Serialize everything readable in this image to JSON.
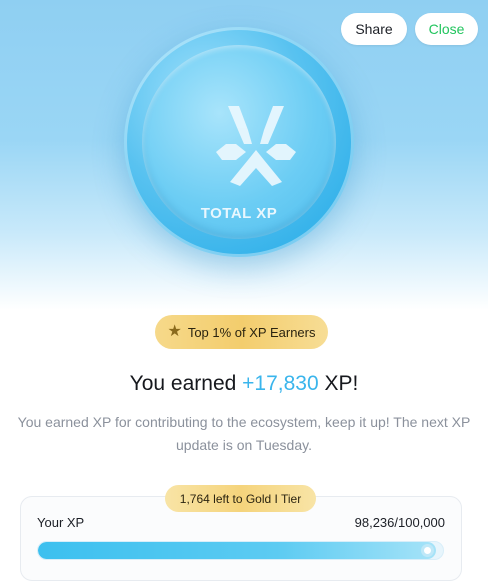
{
  "header": {
    "share_label": "Share",
    "close_label": "Close"
  },
  "coin": {
    "label": "TOTAL XP",
    "icon": "xp-logo-icon"
  },
  "badge": {
    "icon": "star-icon",
    "text": "Top 1% of XP Earners"
  },
  "headline": {
    "prefix": "You earned ",
    "amount": "+17,830",
    "suffix": " XP!"
  },
  "description": "You earned XP for contributing to the ecosystem, keep it up! The next XP update is on Tuesday.",
  "progress": {
    "tier_note": "1,764 left to Gold I Tier",
    "label": "Your XP",
    "value_text": "98,236/100,000",
    "current": 98236,
    "max": 100000
  },
  "colors": {
    "accent": "#3ab5ec",
    "close_green": "#22c55e",
    "gold": "#f3cd6d"
  }
}
